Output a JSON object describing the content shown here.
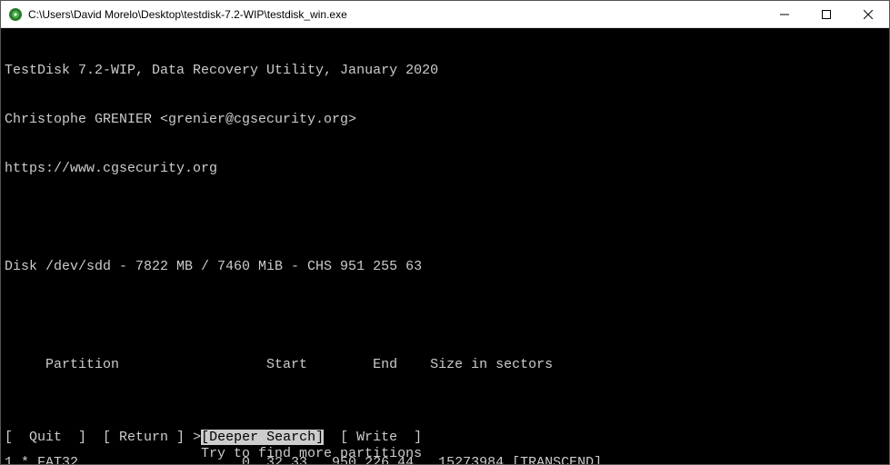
{
  "window": {
    "title": "C:\\Users\\David Morelo\\Desktop\\testdisk-7.2-WIP\\testdisk_win.exe"
  },
  "header": {
    "line1": "TestDisk 7.2-WIP, Data Recovery Utility, January 2020",
    "line2": "Christophe GRENIER <grenier@cgsecurity.org>",
    "line3": "https://www.cgsecurity.org"
  },
  "disk": {
    "line": "Disk /dev/sdd - 7822 MB / 7460 MiB - CHS 951 255 63"
  },
  "table": {
    "header": "     Partition                  Start        End    Size in sectors",
    "row1": "1 * FAT32                    0  32 33   950 226 44   15273984 [TRANSCEND]"
  },
  "menu": {
    "quit": "[  Quit  ]",
    "return": "[ Return ]",
    "deeper_prefix": ">",
    "deeper": "[Deeper Search]",
    "write": "[ Write  ]",
    "hint": "                        Try to find more partitions"
  }
}
